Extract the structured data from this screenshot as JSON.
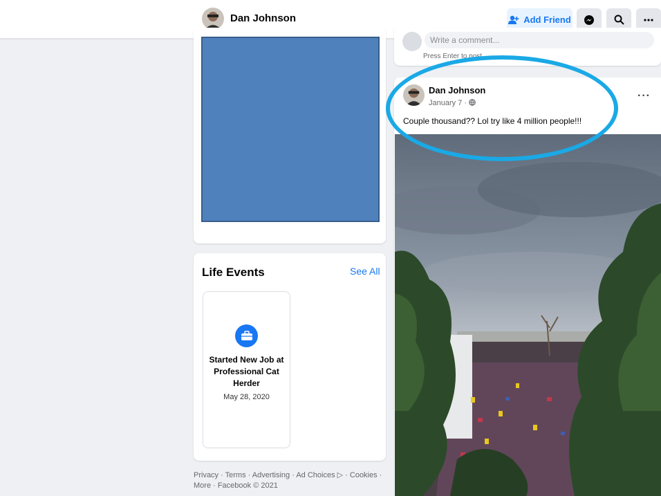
{
  "header": {
    "name": "Dan Johnson",
    "add_friend": "Add Friend",
    "messenger_icon": "messenger-icon",
    "search_icon": "search-icon",
    "more_icon": "more-icon"
  },
  "life_events": {
    "title": "Life Events",
    "see_all": "See All",
    "event": {
      "title": "Started New Job at Professional Cat Herder",
      "date": "May 28, 2020",
      "icon": "briefcase-icon"
    }
  },
  "footer": {
    "text": "Privacy · Terms · Advertising · Ad Choices ▷ · Cookies · More · Facebook © 2021"
  },
  "comment": {
    "placeholder": "Write a comment...",
    "hint": "Press Enter to post."
  },
  "post": {
    "author": "Dan Johnson",
    "date": "January 7 · ",
    "text": "Couple thousand?? Lol try like 4 million people!!!",
    "more": "···"
  },
  "colors": {
    "accent": "#1877f2",
    "highlight": "#1aa9e6",
    "placeholder_box": "#4f81bd"
  }
}
